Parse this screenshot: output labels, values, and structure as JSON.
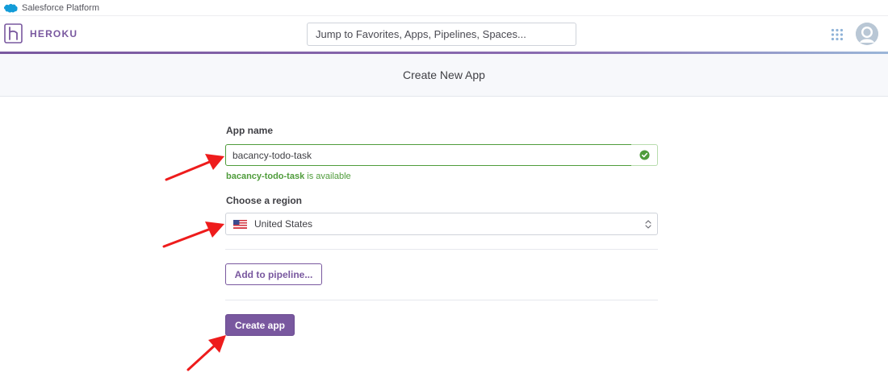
{
  "platform": {
    "label": "Salesforce Platform"
  },
  "header": {
    "brand": "HEROKU",
    "search_placeholder": "Jump to Favorites, Apps, Pipelines, Spaces...",
    "icons": {
      "apps": "apps-grid-icon",
      "avatar": "user-avatar-icon"
    },
    "accent_color": "#79589f"
  },
  "page": {
    "title": "Create New App"
  },
  "form": {
    "app_name_label": "App name",
    "app_name_value": "bacancy-todo-task",
    "availability_name": "bacancy-todo-task",
    "availability_suffix": " is available",
    "valid_icon": "check-circle-icon",
    "region_label": "Choose a region",
    "region_value": "United States",
    "region_flag": "us-flag-icon",
    "add_pipeline_label": "Add to pipeline...",
    "create_label": "Create app"
  },
  "colors": {
    "success": "#4f9c3b",
    "primary": "#79589f",
    "annotation_arrow": "#ee1c1c"
  }
}
